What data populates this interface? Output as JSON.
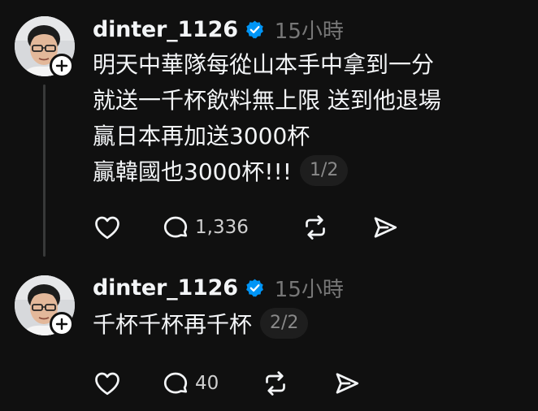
{
  "posts": [
    {
      "username": "dinter_1126",
      "time": "15小時",
      "lines": [
        "明天中華隊每從山本手中拿到一分",
        "就送一千杯飲料無上限 送到他退場",
        "贏日本再加送3000杯",
        "贏韓國也3000杯!!!"
      ],
      "counter": "1/2",
      "comments": "1,336"
    },
    {
      "username": "dinter_1126",
      "time": "15小時",
      "lines": [
        "千杯千杯再千杯"
      ],
      "counter": "2/2",
      "comments": "40"
    }
  ],
  "colors": {
    "background": "#101010",
    "text": "#f3f5f7",
    "muted": "#777777",
    "verified": "#0095f6"
  },
  "icons": [
    "avatar-photo",
    "plus-icon",
    "verified-badge-icon",
    "heart-icon",
    "comment-icon",
    "repost-icon",
    "share-icon"
  ]
}
